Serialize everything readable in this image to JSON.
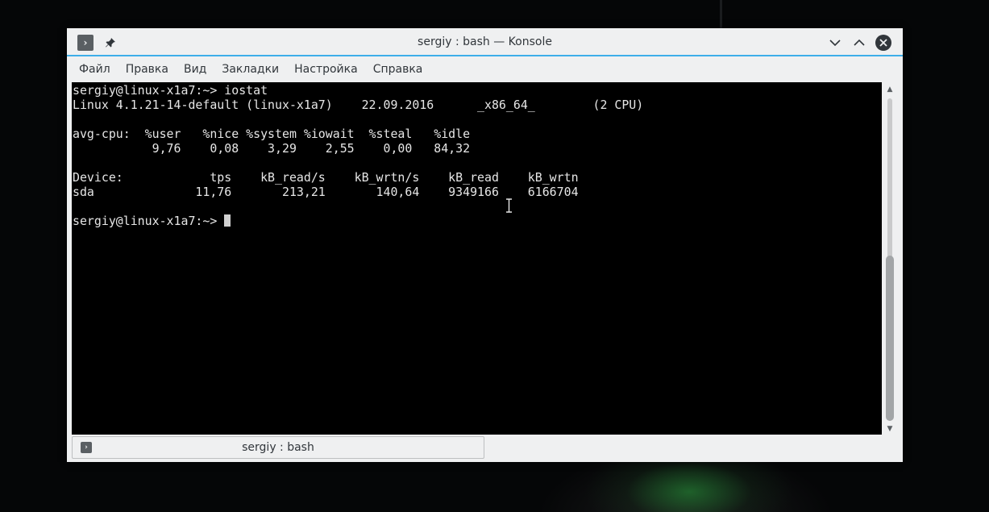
{
  "window": {
    "title": "sergiy : bash — Konsole",
    "menu_glyph": "›",
    "pin_glyph": "📌",
    "minimize_glyph": "⌄",
    "maximize_glyph": "⌃",
    "close_glyph": "✕"
  },
  "menubar": {
    "items": [
      {
        "label": "Файл"
      },
      {
        "label": "Правка"
      },
      {
        "label": "Вид"
      },
      {
        "label": "Закладки"
      },
      {
        "label": "Настройка"
      },
      {
        "label": "Справка"
      }
    ]
  },
  "terminal": {
    "lines": [
      "sergiy@linux-x1a7:~> iostat",
      "Linux 4.1.21-14-default (linux-x1a7)    22.09.2016      _x86_64_        (2 CPU)",
      "",
      "avg-cpu:  %user   %nice %system %iowait  %steal   %idle",
      "           9,76    0,08    3,29    2,55    0,00   84,32",
      "",
      "Device:            tps    kB_read/s    kB_wrtn/s    kB_read    kB_wrtn",
      "sda              11,76       213,21       140,64    9349166    6166704",
      ""
    ],
    "prompt": "sergiy@linux-x1a7:~> "
  },
  "scrollbar": {
    "up_glyph": "▲",
    "down_glyph": "▼"
  },
  "tabs": [
    {
      "label": "sergiy : bash",
      "icon_glyph": "›"
    }
  ],
  "icons": {
    "menu": "terminal-icon",
    "pin": "pin-icon",
    "minimize": "chevron-down-icon",
    "maximize": "chevron-up-icon",
    "close": "close-icon",
    "tab": "terminal-icon"
  },
  "colors": {
    "accent": "#3daee9",
    "terminal_bg": "#000000",
    "terminal_fg": "#e6e6e6",
    "chrome_bg": "#eff0f1"
  }
}
